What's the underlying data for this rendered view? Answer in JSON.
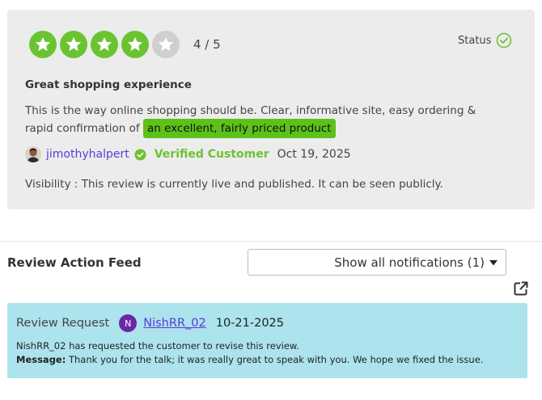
{
  "review": {
    "rating_value": 4,
    "rating_max": 5,
    "rating_text": "4 / 5",
    "status_label": "Status",
    "title": "Great shopping experience",
    "body_text": "This is the way online shopping should be. Clear, informative site, easy ordering & rapid confirmation of",
    "highlight_text": "an excellent, fairly priced product",
    "author": "jimothyhalpert",
    "verified_label": "Verified Customer",
    "date": "Oct 19, 2025",
    "visibility_text": "Visibility : This review is currently live and published. It can be seen publicly."
  },
  "feed": {
    "title": "Review Action Feed",
    "notifications_label": "Show all notifications (1)"
  },
  "request": {
    "type": "Review Request",
    "user_initial": "N",
    "user": "NishRR_02",
    "date": "10-21-2025",
    "summary": "NishRR_02 has requested the customer to revise this review.",
    "message_label": "Message:",
    "message": "Thank you for the talk; it was really great to speak with you. We hope we fixed the issue."
  },
  "colors": {
    "star_on": "#6cc332",
    "star_off": "#cfcfcf",
    "highlight": "#5cc21a",
    "link": "#5b3ad9",
    "request_bg": "#ace3ec",
    "badge": "#6a27a8"
  }
}
